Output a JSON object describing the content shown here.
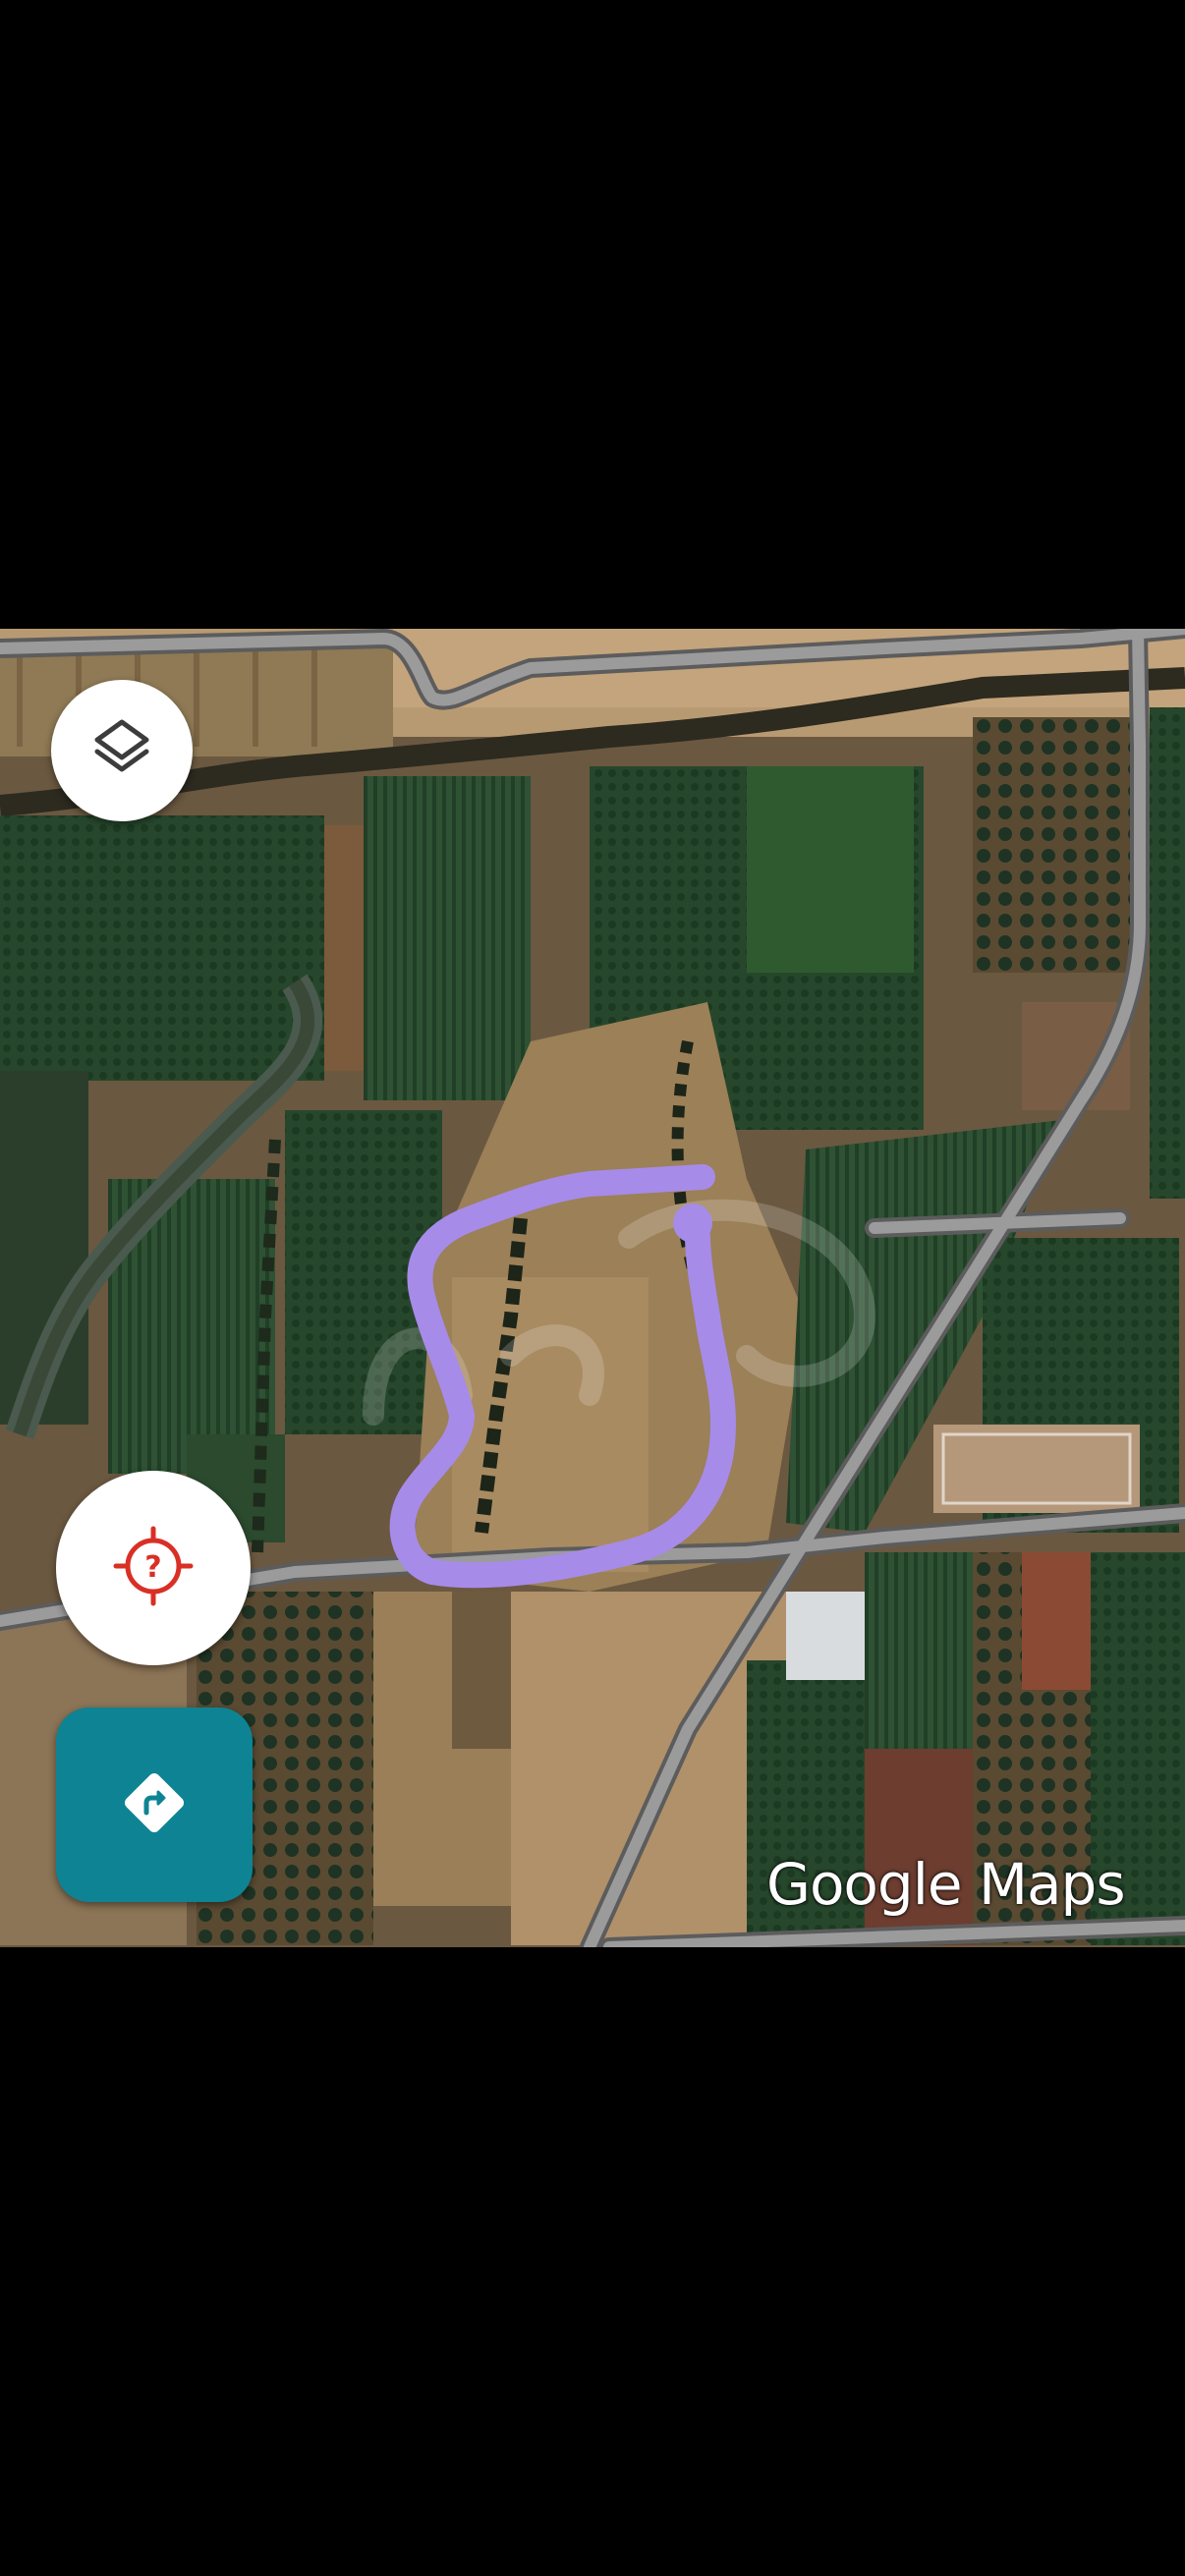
{
  "map": {
    "type": "satellite",
    "attribution": "Google Maps",
    "overlay": {
      "shape": "hand-drawn outline",
      "color": "#a78be8"
    }
  },
  "controls": {
    "layers_icon": "layers-icon",
    "location_icon": "location-unknown-icon",
    "location_icon_color": "#d93025",
    "directions_icon": "directions-icon",
    "directions_color": "#0e8394"
  }
}
